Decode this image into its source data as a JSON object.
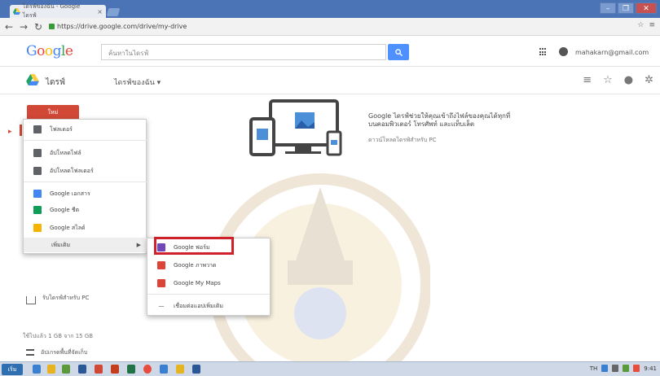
{
  "browser": {
    "tab_title": "ไดรฟ์ของฉัน - Google ไดรฟ์",
    "url": "https://drive.google.com/drive/my-drive",
    "window_buttons": [
      "–",
      "❐",
      "✕"
    ]
  },
  "google_header": {
    "logo": "Google",
    "search_placeholder": "ค้นหาในไดรฟ์",
    "account_email": "mahakarn@gmail.com"
  },
  "drive_header": {
    "title": "ไดรฟ์",
    "location": "ไดรฟ์ของฉัน ▾"
  },
  "sidebar": {
    "new_button": "ใหม่",
    "storage_text": "รับไดรฟ์สำหรับ PC",
    "storage_used": "ใช้ไปแล้ว 1 GB จาก 15 GB",
    "upgrade_text": "อัปเกรดพื้นที่จัดเก็บ"
  },
  "new_menu": {
    "items": [
      {
        "label": "โฟลเดอร์",
        "color": "#5f6368"
      },
      {
        "label": "อัปโหลดไฟล์",
        "color": "#5f6368"
      },
      {
        "label": "อัปโหลดโฟลเดอร์",
        "color": "#5f6368"
      },
      {
        "label": "Google เอกสาร",
        "color": "#4285f4"
      },
      {
        "label": "Google ชีต",
        "color": "#0f9d58"
      },
      {
        "label": "Google สไลด์",
        "color": "#f4b400"
      }
    ],
    "more_label": "เพิ่มเติม",
    "more_chevron": "▶"
  },
  "submenu": {
    "items": [
      {
        "label": "Google ฟอร์ม",
        "color": "#7248b9"
      },
      {
        "label": "Google ภาพวาด",
        "color": "#db4437"
      },
      {
        "label": "Google My Maps",
        "color": "#db4437"
      }
    ],
    "connect_label": "เชื่อมต่อแอปเพิ่มเติม"
  },
  "empty_state": {
    "title": "Google ไดรฟ์ช่วยให้คุณเข้าถึงไฟล์ของคุณได้ทุกที่",
    "title_line2": "บนคอมพิวเตอร์ โทรศัพท์ และแท็บเล็ต",
    "subtitle": "ดาวน์โหลดไดรฟ์สำหรับ PC"
  },
  "taskbar": {
    "start_label": "เริ่ม",
    "tray_lang": "TH",
    "clock": "9:41"
  },
  "colors": {
    "titlebar": "#4a74b5",
    "new_button": "#d14836",
    "highlight": "#d0202a",
    "search_button": "#4d90fe"
  }
}
